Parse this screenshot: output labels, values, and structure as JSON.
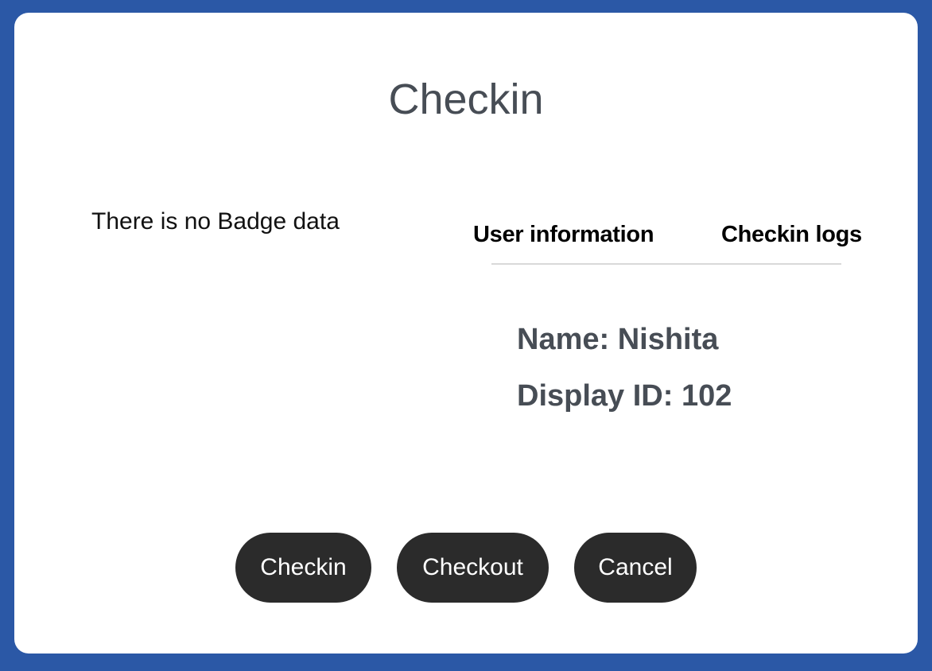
{
  "dialog": {
    "title": "Checkin",
    "badge_message": "There is no Badge data",
    "tabs": [
      {
        "label": "User information"
      },
      {
        "label": "Checkin logs"
      }
    ],
    "user_info": {
      "name_line": "Name: Nishita",
      "display_id_line": "Display ID: 102"
    },
    "buttons": {
      "checkin": "Checkin",
      "checkout": "Checkout",
      "cancel": "Cancel"
    }
  },
  "colors": {
    "background": "#2b58a6",
    "dialog": "#ffffff",
    "button": "#2b2b2b",
    "heading_text": "#474d55"
  }
}
